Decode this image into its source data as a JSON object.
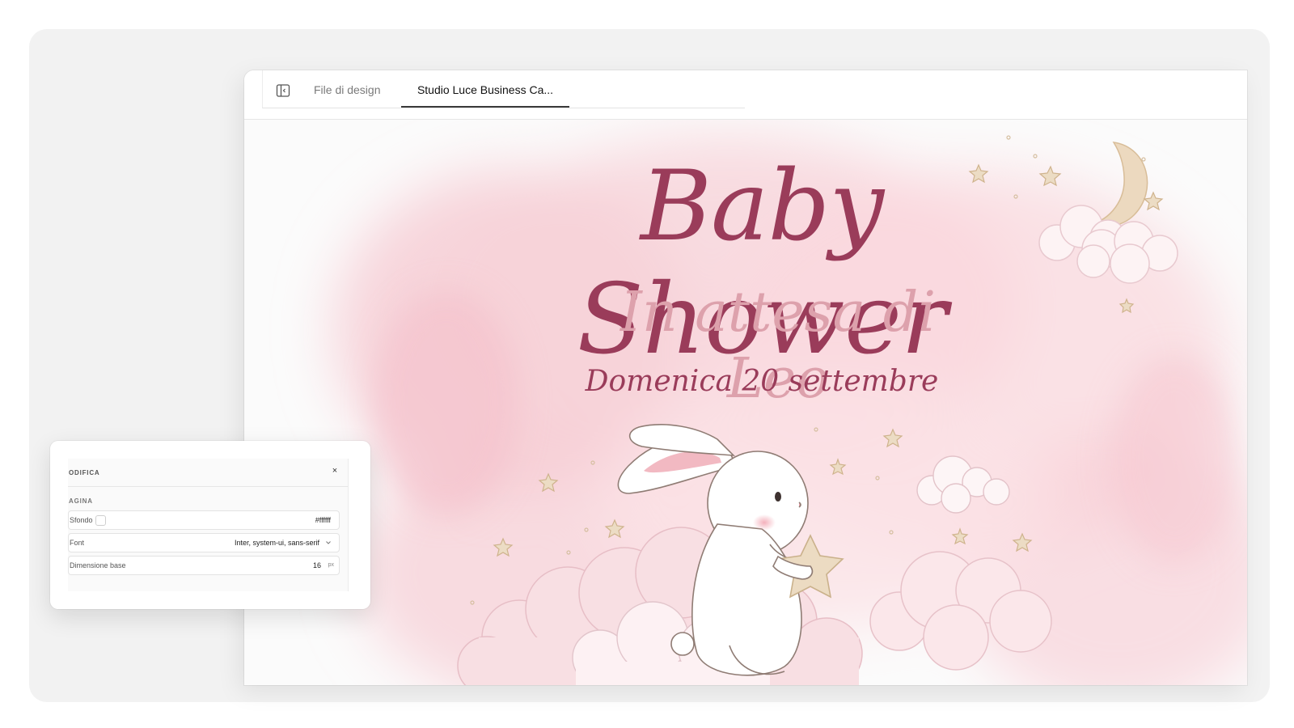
{
  "tabs": {
    "inactive_label": "File di design",
    "active_label": "Studio Luce Business Ca..."
  },
  "invite": {
    "title": "Baby Shower",
    "subtitle": "In attesa di Leo",
    "date": "Domenica 20 settembre"
  },
  "edit_panel": {
    "title": "ODIFICA",
    "close_label": "×",
    "section_label": "AGINA",
    "fields": [
      {
        "label": "Sfondo",
        "value": "#ffffff"
      },
      {
        "label": "Font",
        "value": "Inter, system-ui, sans-serif"
      },
      {
        "label": "Dimensione base",
        "value": "16",
        "unit": "px"
      }
    ]
  },
  "colors": {
    "title": "#9a3c5a",
    "subtitle": "#dda1ac",
    "watercolor": "#f5c9d1",
    "star": "#d9c3a3"
  },
  "icons": [
    "sidebar-toggle-icon",
    "close-icon",
    "chevron-down-icon",
    "moon-icon",
    "star-icon",
    "cloud-icon",
    "bunny-illustration"
  ]
}
